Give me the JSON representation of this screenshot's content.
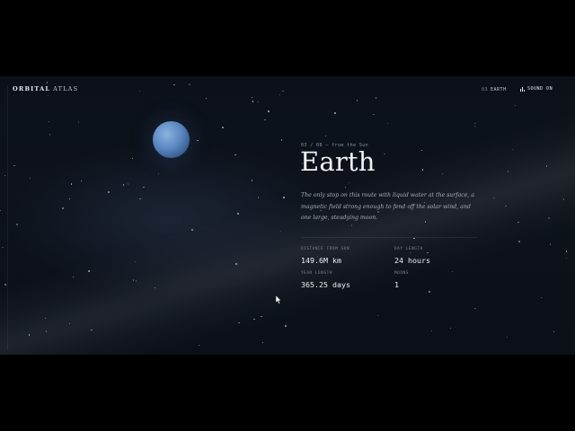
{
  "header": {
    "logo_bold": "ORBITAL",
    "logo_light": "ATLAS",
    "nav_planet_number": "03",
    "nav_planet_name": "EARTH",
    "sound_label": "SOUND ON"
  },
  "planet": {
    "eyebrow": "03 / 08 — from the Sun",
    "name": "Earth",
    "description": "The only stop on this route with liquid water at the surface, a magnetic field strong enough to fend off the solar wind, and one large, steadying moon.",
    "color": "#5a87c0"
  },
  "stats": [
    {
      "label": "DISTANCE FROM SUN",
      "value": "149.6M km"
    },
    {
      "label": "DAY LENGTH",
      "value": "24 hours"
    },
    {
      "label": "YEAR LENGTH",
      "value": "365.25 days"
    },
    {
      "label": "MOONS",
      "value": "1"
    }
  ],
  "colors": {
    "background": "#0d121b",
    "text_primary": "#f1f2f5",
    "text_muted": "#8b93a3"
  }
}
